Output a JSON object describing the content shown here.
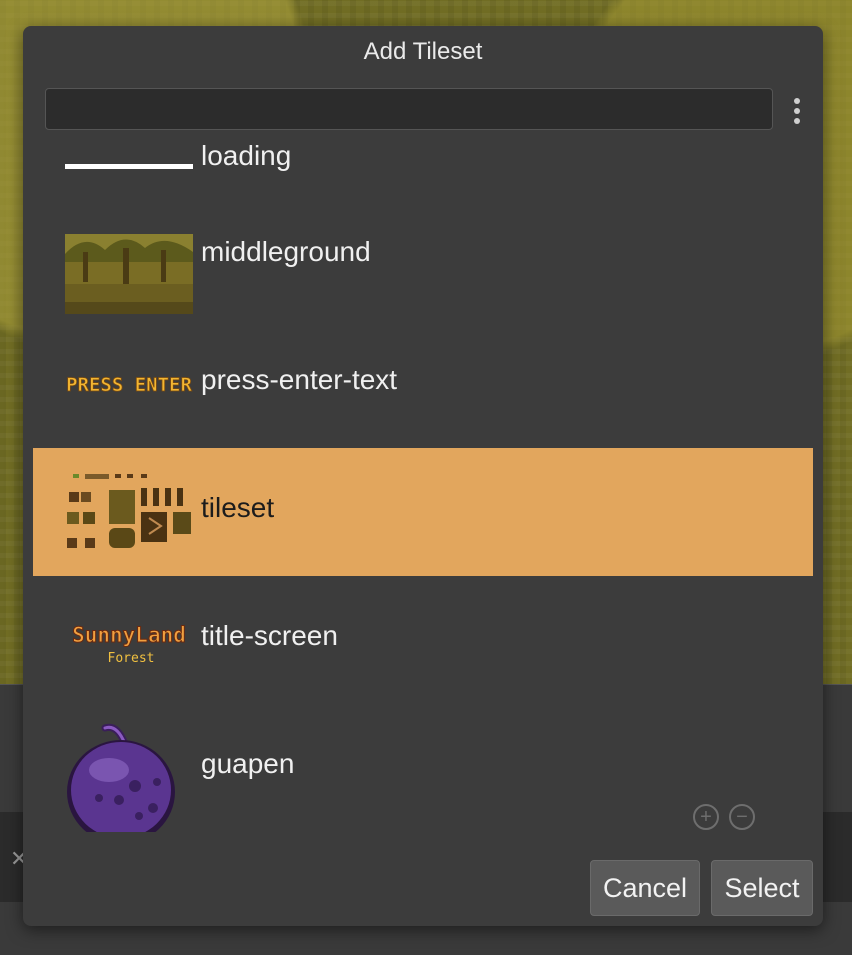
{
  "dialog": {
    "title": "Add Tileset",
    "search": {
      "value": "",
      "placeholder": ""
    },
    "menu_icon": "more-vertical-icon"
  },
  "items": [
    {
      "label": "loading",
      "thumbnail": "loading-bar-thumbnail",
      "selected": false
    },
    {
      "label": "middleground",
      "thumbnail": "forest-trees-thumbnail",
      "selected": false
    },
    {
      "label": "press-enter-text",
      "thumbnail": "press-enter-thumbnail",
      "thumbnail_text": "PRESS ENTER",
      "selected": false
    },
    {
      "label": "tileset",
      "thumbnail": "tile-pieces-thumbnail",
      "selected": true
    },
    {
      "label": "title-screen",
      "thumbnail": "sunnyland-logo-thumbnail",
      "thumbnail_text": [
        "SunnyLand",
        "Forest"
      ],
      "selected": false
    },
    {
      "label": "guapen",
      "thumbnail": "purple-fruit-thumbnail",
      "selected": false
    }
  ],
  "zoom": {
    "zoom_in_icon": "zoom-in-icon",
    "zoom_out_icon": "zoom-out-icon"
  },
  "buttons": {
    "cancel": "Cancel",
    "select": "Select"
  },
  "colors": {
    "selection": "#e2a65d",
    "dialog_bg": "#3c3c3c"
  }
}
